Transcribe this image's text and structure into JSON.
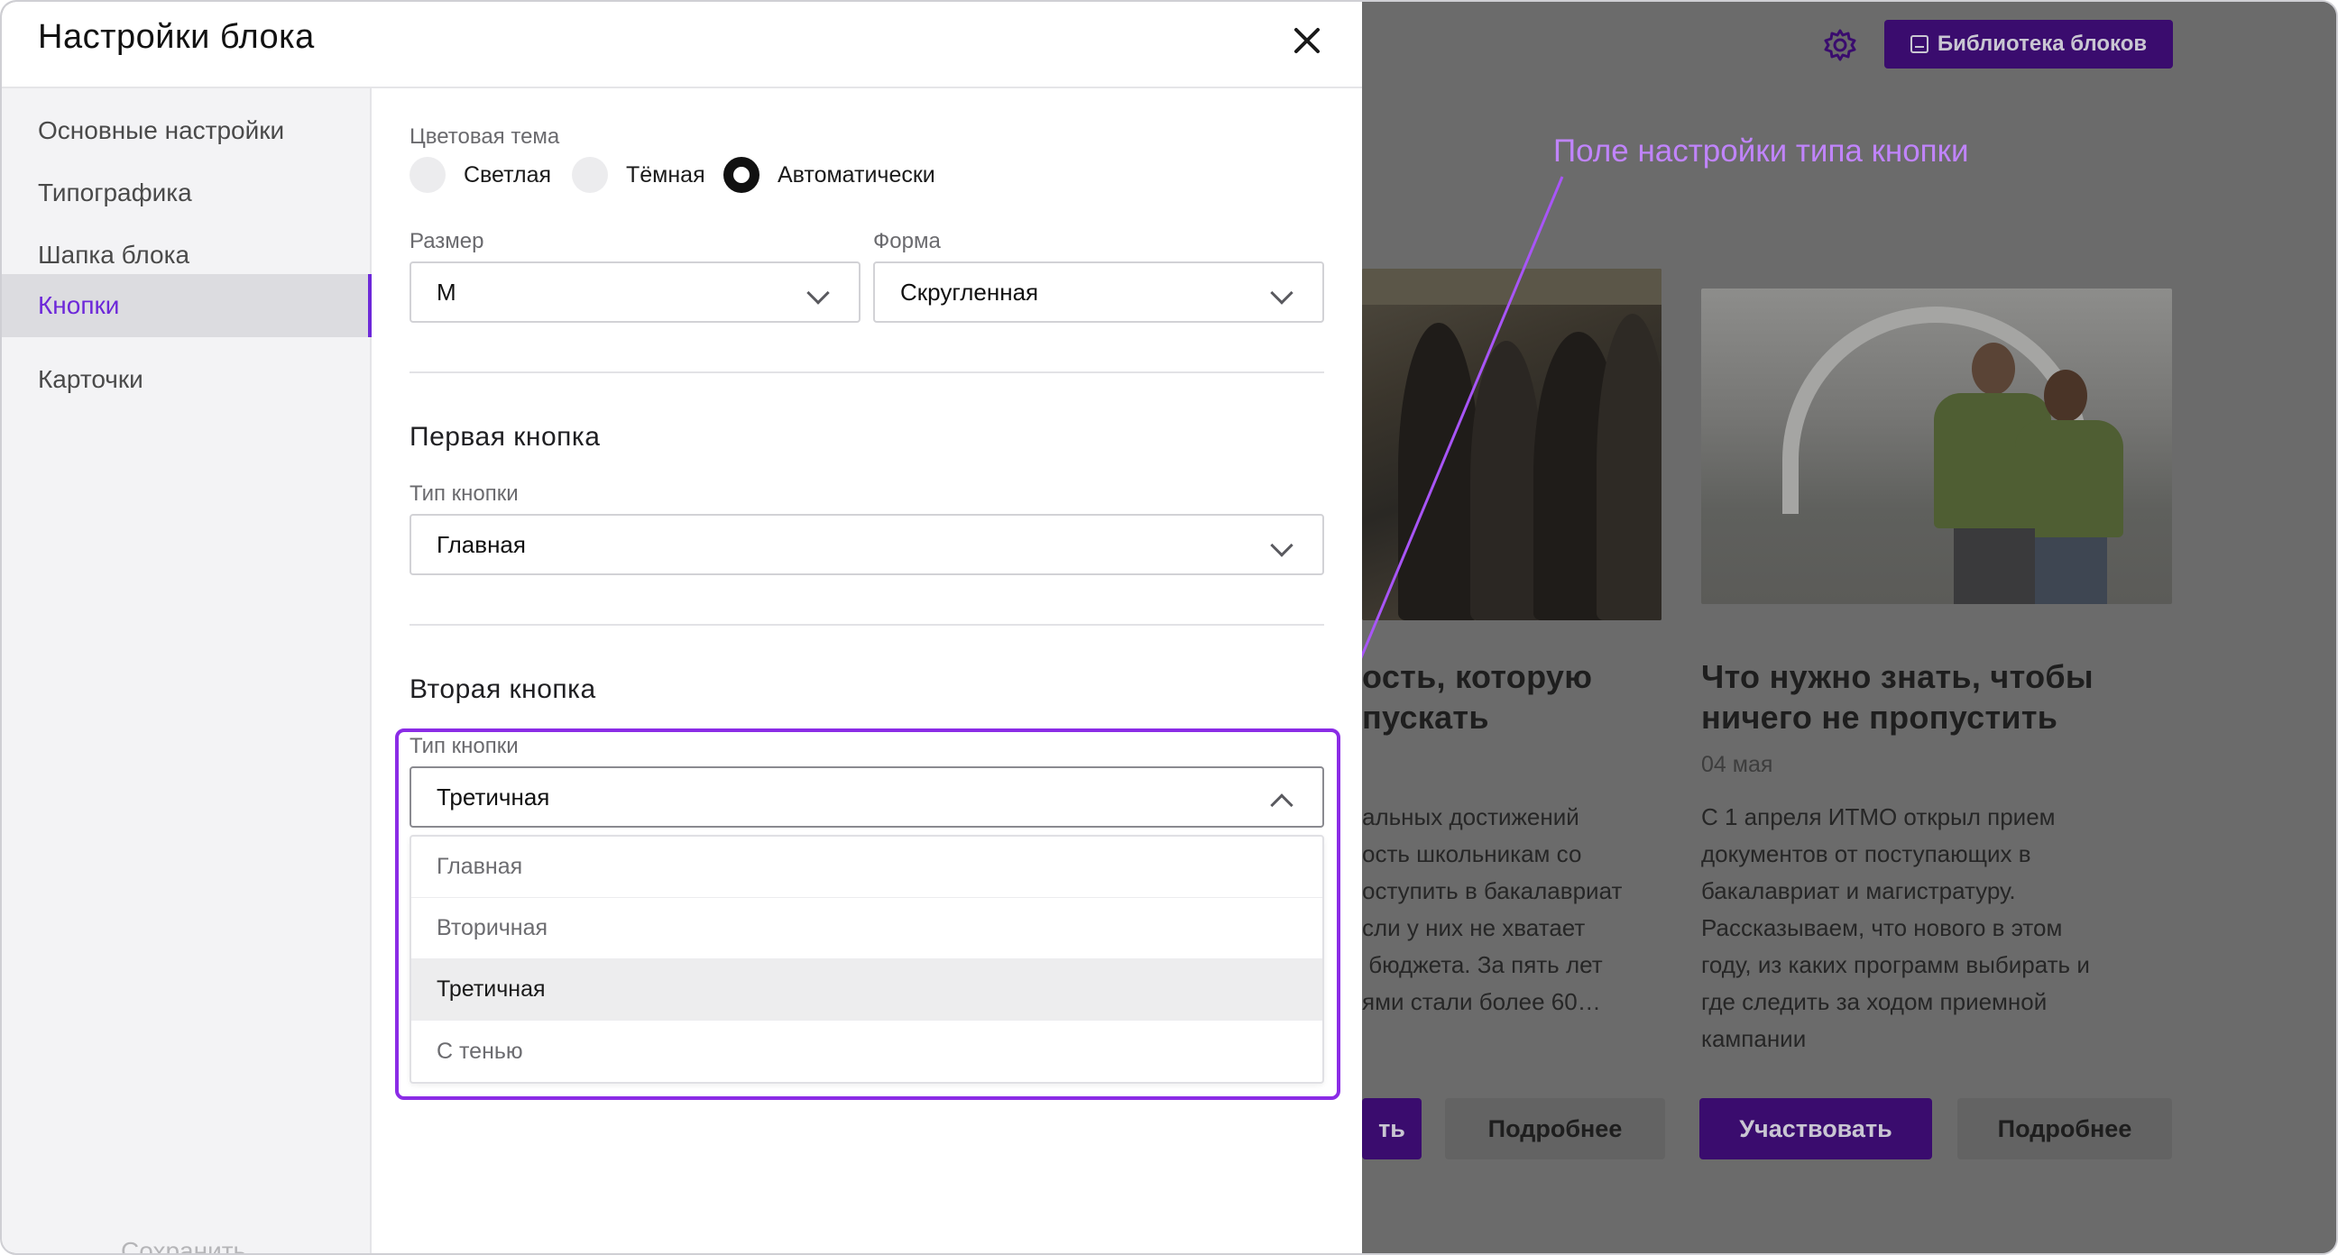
{
  "panel": {
    "title": "Настройки блока",
    "sidebar": {
      "items": [
        {
          "label": "Основные настройки"
        },
        {
          "label": "Типографика"
        },
        {
          "label": "Шапка блока"
        },
        {
          "label": "Кнопки",
          "active": true
        },
        {
          "label": "Карточки"
        }
      ],
      "save_label": "Сохранить"
    },
    "theme": {
      "label": "Цветовая тема",
      "options": [
        "Светлая",
        "Тёмная",
        "Автоматически"
      ],
      "selected": "Автоматически"
    },
    "size": {
      "label": "Размер",
      "value": "M"
    },
    "shape": {
      "label": "Форма",
      "value": "Скругленная"
    },
    "first_button": {
      "title": "Первая кнопка",
      "type_label": "Тип кнопки",
      "type_value": "Главная"
    },
    "second_button": {
      "title": "Вторая кнопка",
      "type_label": "Тип кнопки",
      "type_value": "Третичная",
      "options": [
        "Главная",
        "Вторичная",
        "Третичная",
        "С тенью"
      ]
    }
  },
  "annotation": {
    "text": "Поле настройки типа кнопки",
    "color": "#c084fc",
    "box_color": "#8b2ce6"
  },
  "background": {
    "library_button": "Библиотека блоков",
    "card1": {
      "title_line1": "ость, которую",
      "title_line2": "пускать",
      "body": [
        "альных достижений",
        "ость школьникам со",
        "оступить в бакалавриат",
        "сли у них не хватает",
        " бюджета. За пять лет",
        "ями стали более 60…"
      ],
      "primary_btn": "ть",
      "secondary_btn": "Подробнее"
    },
    "card2": {
      "title_line1": "Что нужно знать, чтобы",
      "title_line2": "ничего не пропустить",
      "date": "04 мая",
      "body": [
        "С 1 апреля ИТМО открыл прием",
        "документов от поступающих в",
        "бакалавриат и магистратуру.",
        "Рассказываем, что нового в этом",
        "году, из каких программ выбирать и",
        "где следить за ходом приемной",
        "кампании"
      ],
      "primary_btn": "Участвовать",
      "secondary_btn": "Подробнее"
    }
  },
  "colors": {
    "accent": "#6d28d9",
    "primary_btn_dimmed": "#3a0c6e"
  }
}
